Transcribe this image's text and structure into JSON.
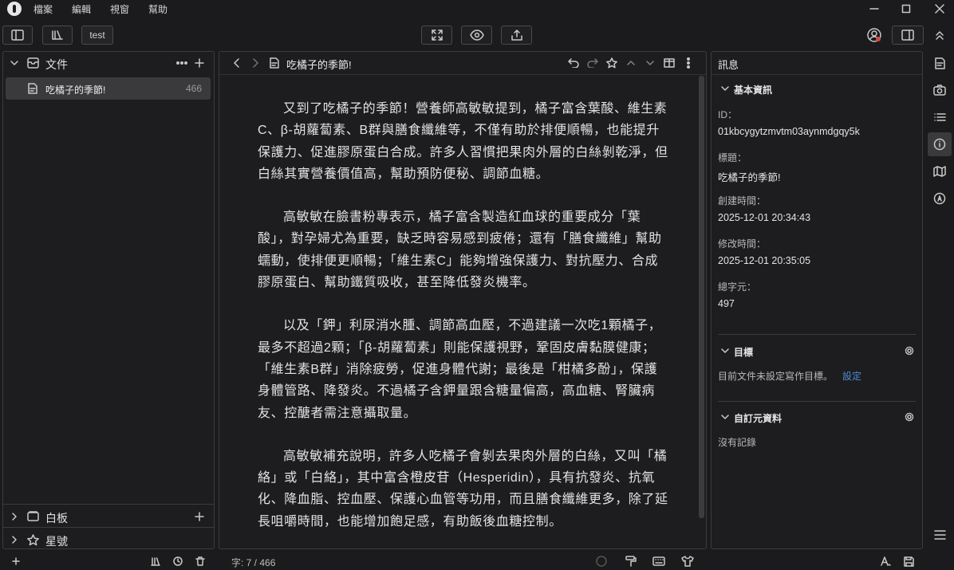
{
  "menu": [
    "檔案",
    "編輯",
    "視窗",
    "幫助"
  ],
  "toolbar": {
    "tab_label": "test"
  },
  "sidebar": {
    "files_title": "文件",
    "file_name": "吃橘子的季節!",
    "file_count": "466",
    "whiteboard_title": "白板",
    "starred_title": "星號"
  },
  "editor": {
    "title": "吃橘子的季節!",
    "paragraphs": [
      "又到了吃橘子的季節！營養師高敏敏提到，橘子富含葉酸、維生素C、β-胡蘿蔔素、B群與膳食纖維等，不僅有助於排便順暢，也能提升保護力、促進膠原蛋白合成。許多人習慣把果肉外層的白絲剝乾淨，但白絲其實營養價值高，幫助預防便秘、調節血糖。",
      "高敏敏在臉書粉專表示，橘子富含製造紅血球的重要成分「葉酸」，對孕婦尤為重要，缺乏時容易感到疲倦；還有「膳食纖維」幫助蠕動，使排便更順暢；「維生素C」能夠增強保護力、對抗壓力、合成膠原蛋白、幫助鐵質吸收，甚至降低發炎機率。",
      "以及「鉀」利尿消水腫、調節高血壓，不過建議一次吃1顆橘子，最多不超過2顆；「β-胡蘿蔔素」則能保護視野，鞏固皮膚黏膜健康；「維生素B群」消除疲勞，促進身體代謝；最後是「柑橘多酚」，保護身體管路、降發炎。不過橘子含鉀量跟含糖量偏高，高血糖、腎臟病友、控醣者需注意攝取量。",
      "高敏敏補充說明，許多人吃橘子會剝去果肉外層的白絲，又叫「橘絡」或「白絡」，其中富含橙皮苷（Hesperidin），具有抗發炎、抗氧化、降血脂、控血壓、保護心血管等功用，而且膳食纖維更多，除了延長咀嚼時間，也能增加飽足感，有助飯後血糖控制。"
    ]
  },
  "info": {
    "header": "訊息",
    "basic_title": "基本資訊",
    "id_label": "ID：",
    "id_value": "01kbcygytzmvtm03aynmdgqy5k",
    "title_label": "標題：",
    "title_value": "吃橘子的季節!",
    "created_label": "創建時間：",
    "created_value": "2025-12-01 20:34:43",
    "modified_label": "修改時間：",
    "modified_value": "2025-12-01 20:35:05",
    "chars_label": "總字元：",
    "chars_value": "497",
    "goal_title": "目標",
    "goal_text": "目前文件未設定寫作目標。",
    "goal_link": "設定",
    "meta_title": "自訂元資料",
    "meta_empty": "沒有記錄"
  },
  "status": {
    "word_count": "字: 7 / 466"
  },
  "colors": {
    "link": "#4c8dd6",
    "background": "#1b1b1d",
    "panel": "#1d1d1f",
    "selected": "#3a3a3d"
  }
}
